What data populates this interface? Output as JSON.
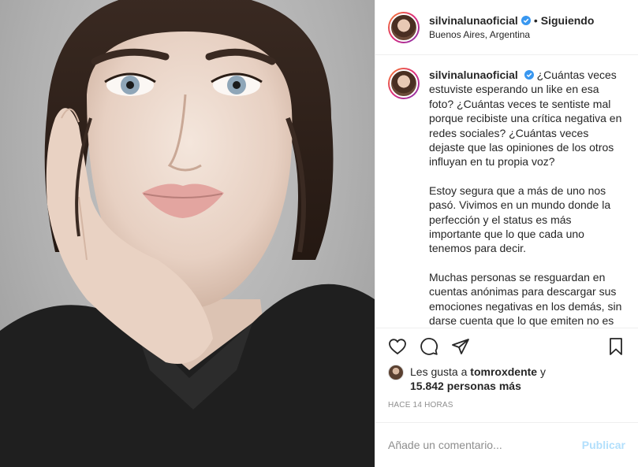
{
  "post": {
    "username": "silvinalunaoficial",
    "follow_status": "Siguiendo",
    "separator": "•",
    "location": "Buenos Aires, Argentina"
  },
  "caption": {
    "username": "silvinalunaoficial",
    "paragraphs": [
      "¿Cuántas veces estuviste esperando un like en esa foto? ¿Cuántas veces te sentiste mal porque recibiste una crítica negativa en redes sociales? ¿Cuántas veces dejaste que las opiniones de los otros influyan en tu propia voz?",
      "Estoy segura que a más de uno nos pasó. Vivimos en un mundo donde la perfección y el status es más importante que lo que cada uno tenemos para decir.",
      "Muchas personas se resguardan en cuentas anónimas para descargar sus emociones negativas en los demás, sin darse cuenta que lo que emiten no es más que un espejo de su ser interior."
    ]
  },
  "likes": {
    "prefix": "Les gusta a",
    "liker": "tomroxdente",
    "conjunction": "y",
    "others": "15.842 personas más"
  },
  "timestamp": "Hace 14 horas",
  "comment": {
    "placeholder": "Añade un comentario...",
    "publish_label": "Publicar"
  },
  "icons": {
    "like": "heart-icon",
    "comment": "comment-icon",
    "share": "share-icon",
    "save": "bookmark-icon",
    "verified": "verified-badge-icon"
  },
  "colors": {
    "verified": "#3897f0",
    "publish_disabled": "#b2dffc",
    "muted_text": "#8e8e8e",
    "border": "#efefef"
  }
}
